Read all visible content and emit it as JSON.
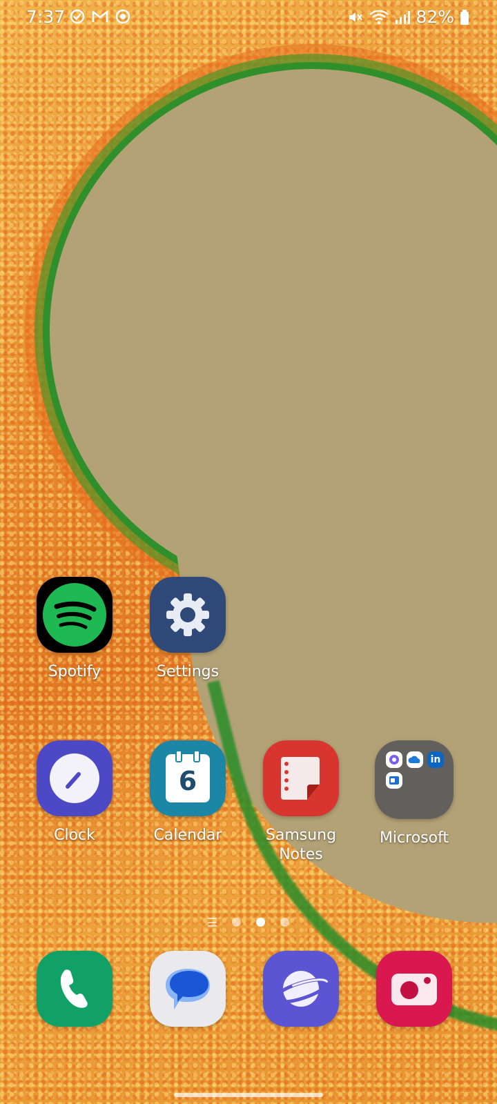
{
  "status_bar": {
    "time": "7:37",
    "battery": "82%",
    "left_icons": [
      "check-circle-icon",
      "gmail-icon",
      "sync-icon"
    ],
    "right_icons": [
      "mute-icon",
      "wifi-icon",
      "signal-icon",
      "battery-icon"
    ]
  },
  "home": {
    "row1": [
      {
        "label": "Spotify",
        "icon": "spotify-icon"
      },
      {
        "label": "Settings",
        "icon": "gear-icon"
      }
    ],
    "row2": [
      {
        "label": "Clock",
        "icon": "clock-icon"
      },
      {
        "label": "Calendar",
        "icon": "calendar-icon",
        "day": "6"
      },
      {
        "label": "Samsung\nNotes",
        "icon": "notes-icon"
      },
      {
        "label": "Microsoft",
        "icon": "folder-icon"
      }
    ]
  },
  "page_indicator": {
    "pages": 3,
    "active": 2
  },
  "dock": [
    {
      "name": "Phone",
      "icon": "phone-icon"
    },
    {
      "name": "Messages",
      "icon": "messages-icon"
    },
    {
      "name": "Internet",
      "icon": "internet-icon"
    },
    {
      "name": "Camera",
      "icon": "camera-icon"
    }
  ],
  "colors": {
    "spotify_green": "#1ed760",
    "settings_blue": "#2f4a78",
    "clock_purple": "#4d49c6",
    "calendar_teal": "#1b86a6",
    "notes_red": "#d8352e",
    "phone_green": "#11a066",
    "internet_purple": "#5b55d4",
    "camera_pink": "#d9184f"
  }
}
